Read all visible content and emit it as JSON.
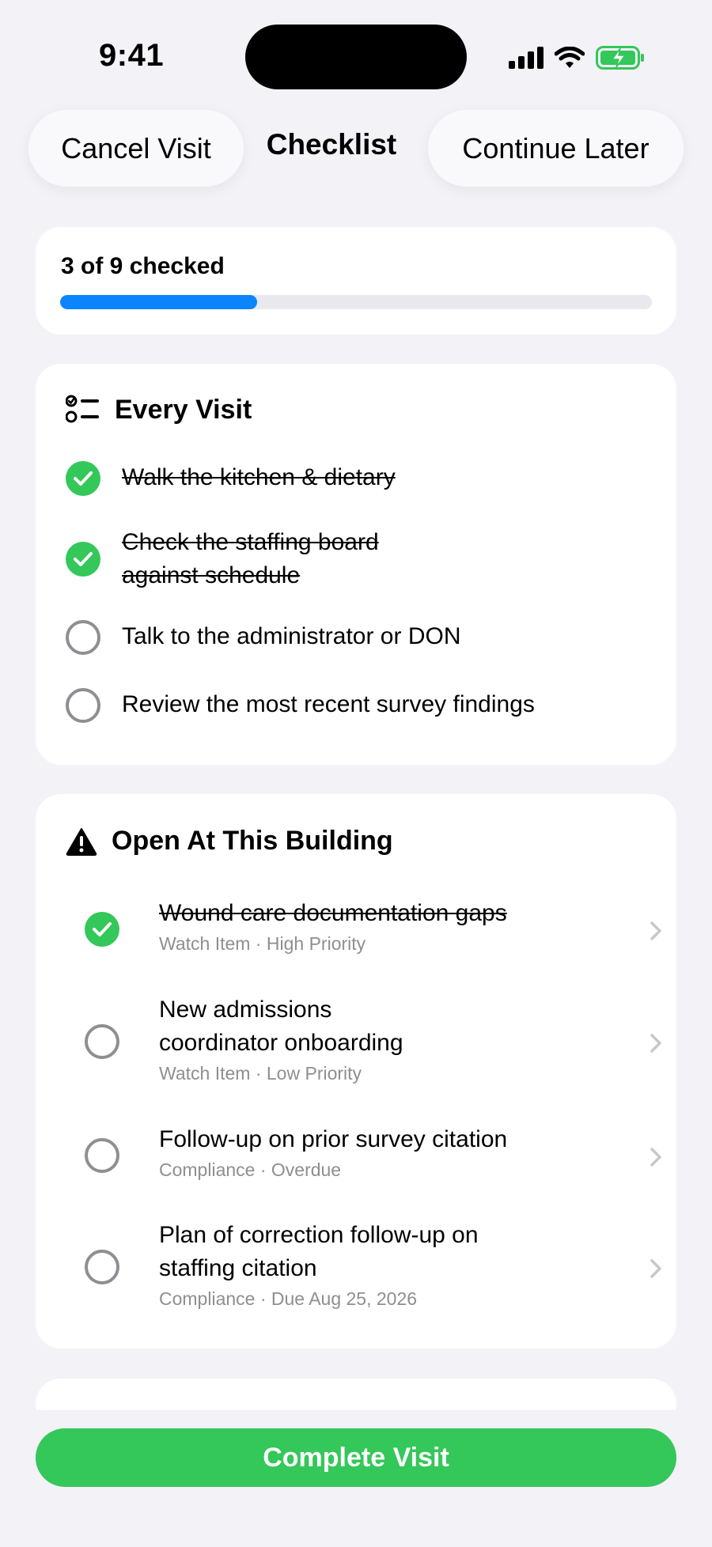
{
  "status_bar": {
    "time": "9:41"
  },
  "nav": {
    "cancel_label": "Cancel Visit",
    "title": "Checklist",
    "continue_label": "Continue Later"
  },
  "progress": {
    "label": "3 of 9 checked",
    "checked": 3,
    "total": 9,
    "color": "#0a84ff"
  },
  "every_visit": {
    "title": "Every Visit",
    "items": [
      {
        "text": "Walk the kitchen & dietary",
        "checked": true
      },
      {
        "line1": "Check the staffing board",
        "line2": "against schedule",
        "checked": true
      },
      {
        "text": "Talk to the administrator or DON",
        "checked": false
      },
      {
        "text": "Review the most recent survey findings",
        "checked": false
      }
    ]
  },
  "open_items": {
    "title": "Open At This Building",
    "items": [
      {
        "title": "Wound care documentation gaps",
        "subtitle": "Watch Item · High Priority",
        "checked": true
      },
      {
        "line1": "New admissions",
        "line2": "coordinator onboarding",
        "subtitle": "Watch Item · Low Priority",
        "checked": false
      },
      {
        "title": "Follow-up on prior survey citation",
        "subtitle": "Compliance · Overdue",
        "checked": false
      },
      {
        "line1": "Plan of correction follow-up on",
        "line2": "staffing citation",
        "subtitle": "Compliance · Due Aug 25, 2026",
        "checked": false
      }
    ]
  },
  "footer": {
    "complete_label": "Complete Visit",
    "accent": "#34c759"
  }
}
